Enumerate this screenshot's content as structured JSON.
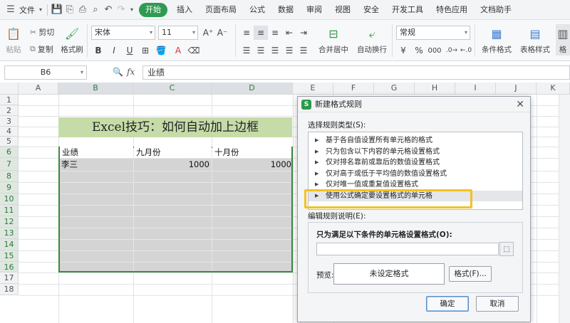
{
  "menu": {
    "file": "文件",
    "tabs": [
      "开始",
      "插入",
      "页面布局",
      "公式",
      "数据",
      "审阅",
      "视图",
      "安全",
      "开发工具",
      "特色应用",
      "文档助手"
    ],
    "active_tab": "开始"
  },
  "ribbon": {
    "paste": "粘贴",
    "cut": "剪切",
    "copy": "复制",
    "format_painter": "格式刷",
    "font_name": "宋体",
    "font_size": "11",
    "merge_center": "合并居中",
    "wrap_text": "自动换行",
    "number_format": "常规",
    "percent": "%",
    "thousands": "000",
    "cond_format": "条件格式",
    "table_style": "表格样式",
    "more": "格"
  },
  "formula_bar": {
    "cell_ref": "B6",
    "fx": "fx",
    "content": "业绩"
  },
  "sheet": {
    "columns": [
      "A",
      "B",
      "C",
      "D",
      "E",
      "F",
      "G",
      "H",
      "I",
      "J",
      "K"
    ],
    "rows": [
      "1",
      "2",
      "3",
      "4",
      "5",
      "6",
      "7",
      "8",
      "9",
      "10",
      "11",
      "12",
      "13",
      "14",
      "15",
      "16",
      "17",
      "18"
    ],
    "title": "Excel技巧：如何自动加上边框",
    "headers": [
      "业绩",
      "九月份",
      "十月份"
    ],
    "row7": {
      "name": "李三",
      "sep": "1000",
      "oct": "1000"
    }
  },
  "dialog": {
    "title": "新建格式规则",
    "select_type_label": "选择规则类型(S):",
    "rule_types": [
      "基于各自值设置所有单元格的格式",
      "只为包含以下内容的单元格设置格式",
      "仅对排名靠前或靠后的数值设置格式",
      "仅对高于或低于平均值的数值设置格式",
      "仅对唯一值或重复值设置格式",
      "使用公式确定要设置格式的单元格"
    ],
    "selected_index": 5,
    "edit_desc_label": "编辑规则说明(E):",
    "formula_label": "只为满足以下条件的单元格设置格式(O):",
    "formula_value": "",
    "preview_label": "预览:",
    "preview_text": "未设定格式",
    "format_button": "格式(F)...",
    "ok_button": "确定",
    "cancel_button": "取消"
  },
  "colors": {
    "active_tab": "#2f9b52",
    "title_fill": "#c6dca8",
    "selection_border": "#3b8a3e",
    "highlight": "#f2c227"
  }
}
